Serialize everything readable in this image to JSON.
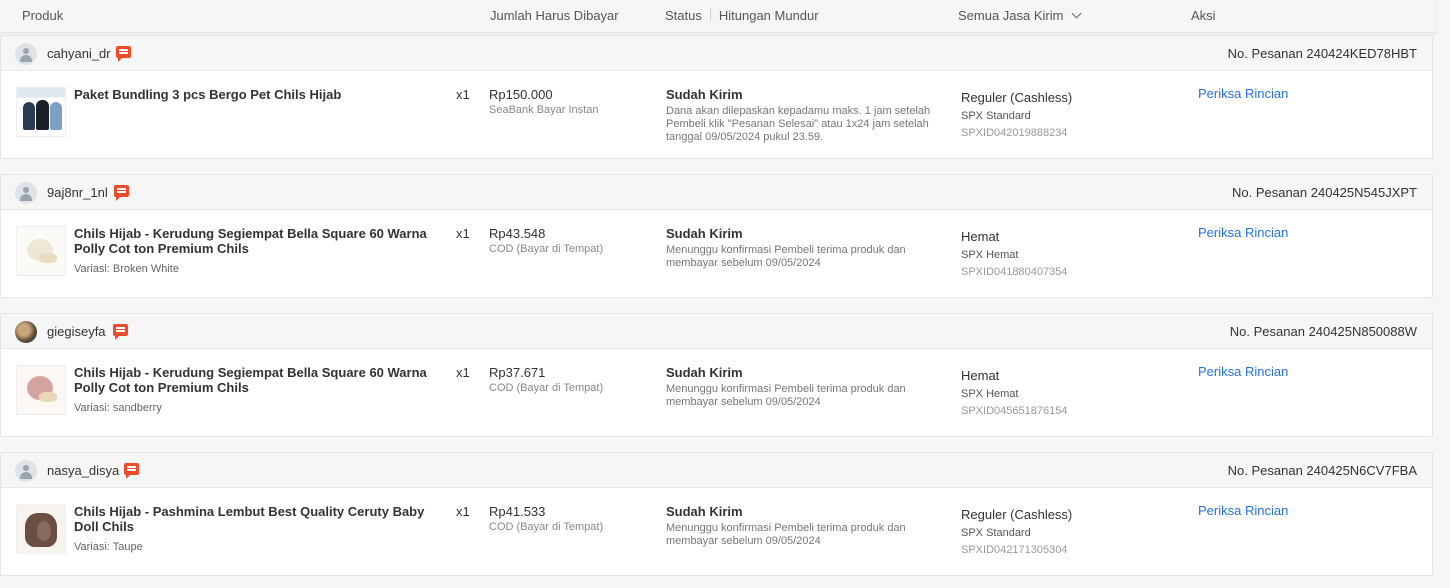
{
  "header": {
    "produk": "Produk",
    "jumlah": "Jumlah Harus Dibayar",
    "status": "Status",
    "hitungan": "Hitungan Mundur",
    "jasa_kirim": "Semua Jasa Kirim",
    "aksi": "Aksi"
  },
  "orders": [
    {
      "username": "cahyani_dr",
      "order_no": "No. Pesanan 240424KED78HBT",
      "product_name": "Paket Bundling 3 pcs Bergo Pet Chils Hijab",
      "variant": "",
      "qty": "x1",
      "price": "Rp150.000",
      "payment": "SeaBank Bayar Instan",
      "status": "Sudah Kirim",
      "status_desc": "Dana akan dilepaskan kepadamu maks. 1 jam setelah Pembeli klik \"Pesanan Selesai\" atau 1x24 jam setelah tanggal 09/05/2024 pukul 23.59.",
      "shipping_name": "Reguler (Cashless)",
      "shipping_type": "SPX Standard",
      "shipping_id": "SPXID042019888234",
      "action": "Periksa Rincian"
    },
    {
      "username": "9aj8nr_1nl",
      "order_no": "No. Pesanan 240425N545JXPT",
      "product_name": "Chils Hijab - Kerudung Segiempat Bella Square 60 Warna Polly Cot ton Premium Chils",
      "variant": "Variasi: Broken White",
      "qty": "x1",
      "price": "Rp43.548",
      "payment": "COD (Bayar di Tempat)",
      "status": "Sudah Kirim",
      "status_desc": "Menunggu konfirmasi Pembeli terima produk dan membayar sebelum 09/05/2024",
      "shipping_name": "Hemat",
      "shipping_type": "SPX Hemat",
      "shipping_id": "SPXID041880407354",
      "action": "Periksa Rincian"
    },
    {
      "username": "giegiseyfa",
      "order_no": "No. Pesanan 240425N850088W",
      "product_name": "Chils Hijab - Kerudung Segiempat Bella Square 60 Warna Polly Cot ton Premium Chils",
      "variant": "Variasi: sandberry",
      "qty": "x1",
      "price": "Rp37.671",
      "payment": "COD (Bayar di Tempat)",
      "status": "Sudah Kirim",
      "status_desc": "Menunggu konfirmasi Pembeli terima produk dan membayar sebelum 09/05/2024",
      "shipping_name": "Hemat",
      "shipping_type": "SPX Hemat",
      "shipping_id": "SPXID045651876154",
      "action": "Periksa Rincian"
    },
    {
      "username": "nasya_disya",
      "order_no": "No. Pesanan 240425N6CV7FBA",
      "product_name": "Chils Hijab - Pashmina Lembut Best Quality Ceruty Baby Doll Chils",
      "variant": "Variasi: Taupe",
      "qty": "x1",
      "price": "Rp41.533",
      "payment": "COD (Bayar di Tempat)",
      "status": "Sudah Kirim",
      "status_desc": "Menunggu konfirmasi Pembeli terima produk dan membayar sebelum 09/05/2024",
      "shipping_name": "Reguler (Cashless)",
      "shipping_type": "SPX Standard",
      "shipping_id": "SPXID042171305304",
      "action": "Periksa Rincian"
    }
  ],
  "colors": {
    "accent_orange": "#ee4d2d",
    "link_blue": "#2673dd"
  }
}
